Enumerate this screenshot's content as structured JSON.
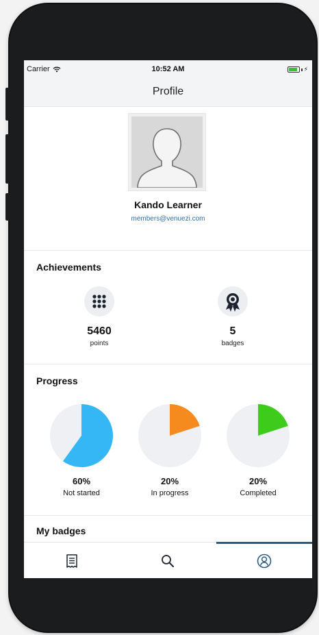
{
  "status_bar": {
    "carrier": "Carrier",
    "time": "10:52 AM",
    "icons": [
      "wifi-icon",
      "battery-icon",
      "charging-bolt-icon"
    ]
  },
  "navbar": {
    "title": "Profile"
  },
  "profile": {
    "name": "Kando Learner",
    "email": "members@venuezi.com",
    "avatar": "person-silhouette-icon"
  },
  "achievements": {
    "title": "Achievements",
    "items": [
      {
        "value": "5460",
        "label": "points",
        "icon": "grid-dots-icon"
      },
      {
        "value": "5",
        "label": "badges",
        "icon": "award-ribbon-icon"
      }
    ]
  },
  "progress": {
    "title": "Progress",
    "items": [
      {
        "percent": "60%",
        "label": "Not started",
        "value": 60,
        "color": "#35b6f5"
      },
      {
        "percent": "20%",
        "label": "In progress",
        "value": 20,
        "color": "#f58a1f"
      },
      {
        "percent": "20%",
        "label": "Completed",
        "value": 20,
        "color": "#3ecb1c"
      }
    ],
    "pie_background": "#eef0f3"
  },
  "badges": {
    "title": "My badges"
  },
  "tabbar": {
    "tabs": [
      {
        "icon": "receipt-list-icon",
        "active": false
      },
      {
        "icon": "search-icon",
        "active": false
      },
      {
        "icon": "profile-circle-icon",
        "active": true
      }
    ],
    "active_color": "#2a5d84"
  }
}
